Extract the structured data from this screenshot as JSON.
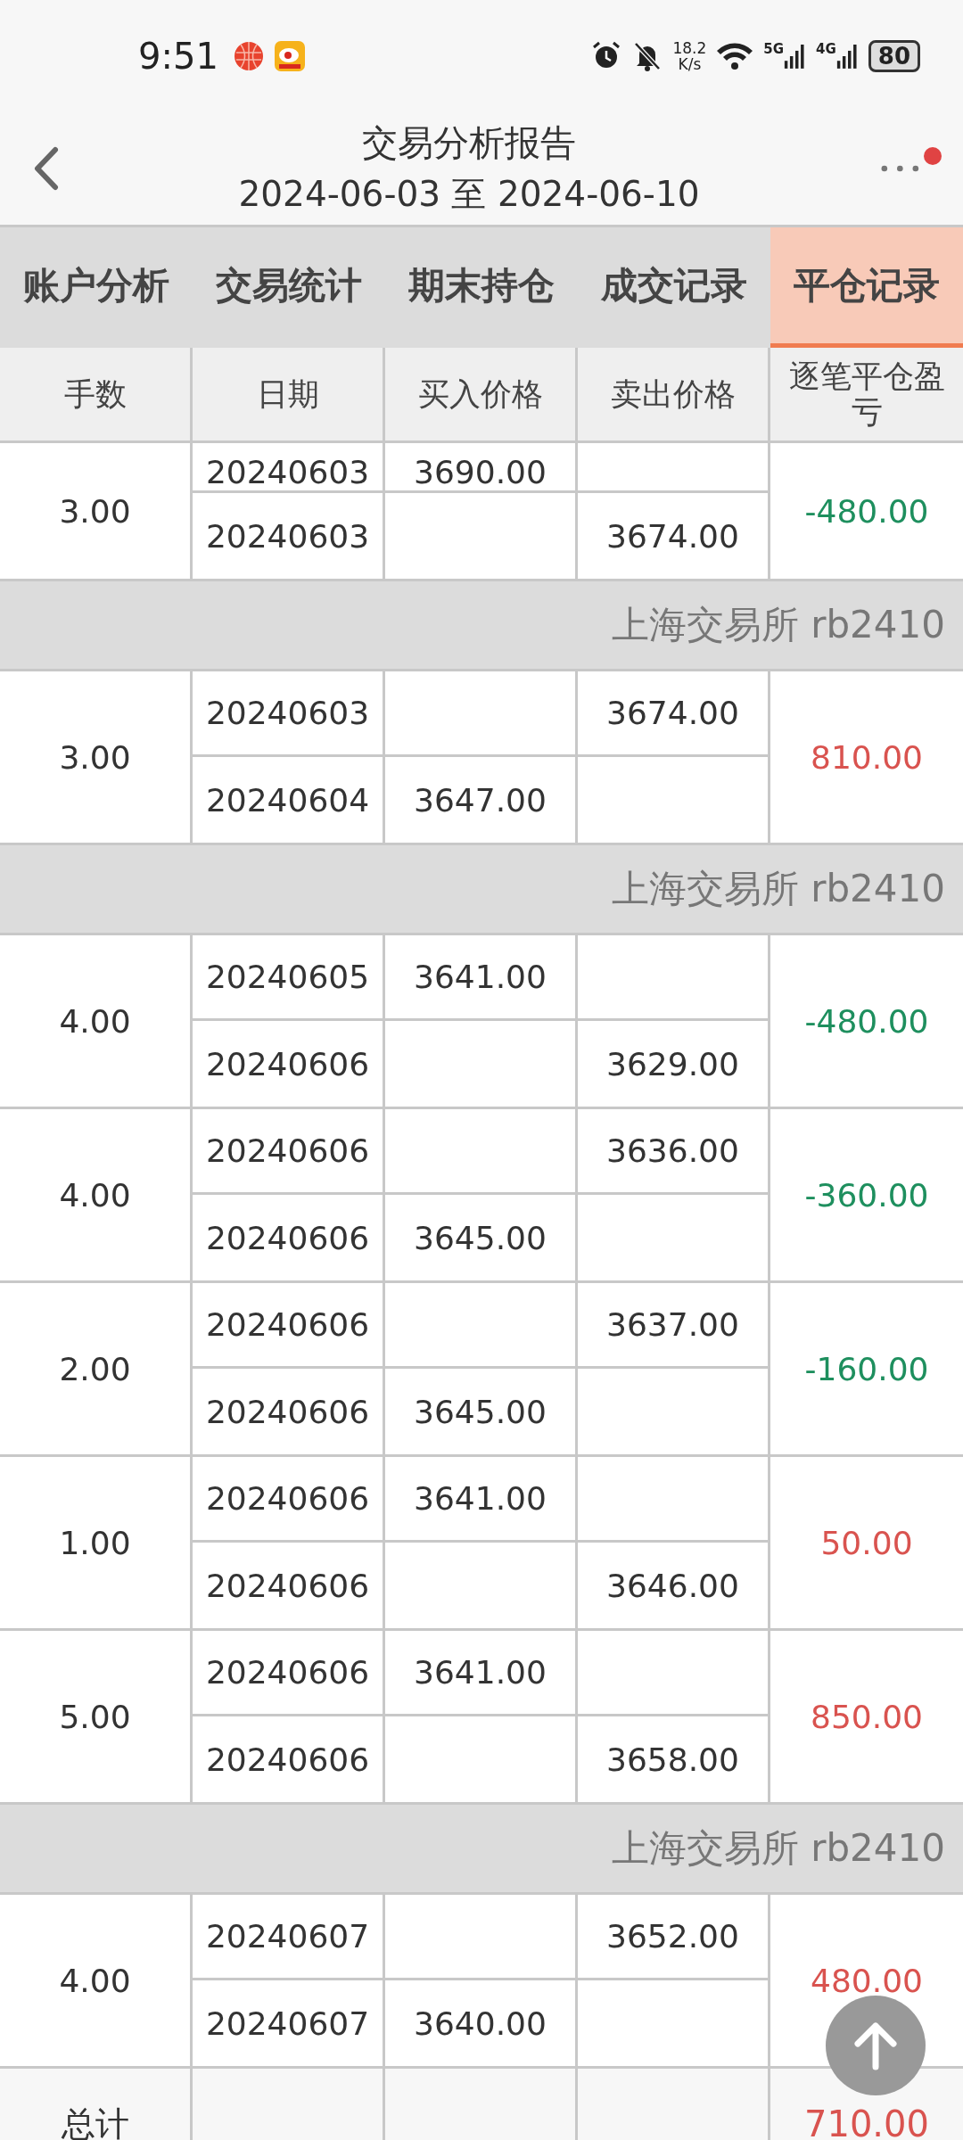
{
  "status_bar": {
    "time": "9:51",
    "speed_value": "18.2",
    "speed_unit": "K/s",
    "network_1": "5G",
    "network_2": "4G",
    "battery": "80"
  },
  "header": {
    "title": "交易分析报告",
    "subtitle": "2024-06-03 至 2024-06-10",
    "notification_dot": true
  },
  "tabs": [
    {
      "label": "账户分析",
      "selected": false
    },
    {
      "label": "交易统计",
      "selected": false
    },
    {
      "label": "期末持仓",
      "selected": false
    },
    {
      "label": "成交记录",
      "selected": false
    },
    {
      "label": "平仓记录",
      "selected": true
    }
  ],
  "table": {
    "columns": [
      "手数",
      "日期",
      "买入价格",
      "卖出价格",
      "逐笔平仓盈亏"
    ],
    "rows": [
      {
        "kind": "trade",
        "lots": "3.00",
        "pnl": "-480.00",
        "color": "#1e8f5e",
        "legs": [
          {
            "date": "20240603",
            "buy": "3690.00"
          },
          {
            "date": "20240603",
            "sell": "3674.00"
          }
        ]
      },
      {
        "kind": "exchange",
        "label": "上海交易所 rb2410"
      },
      {
        "kind": "trade",
        "lots": "3.00",
        "pnl": "810.00",
        "color": "#d9534f",
        "legs": [
          {
            "date": "20240603",
            "sell": "3674.00"
          },
          {
            "date": "20240604",
            "buy": "3647.00"
          }
        ]
      },
      {
        "kind": "exchange",
        "label": "上海交易所 rb2410"
      },
      {
        "kind": "trade",
        "lots": "4.00",
        "pnl": "-480.00",
        "color": "#1e8f5e",
        "legs": [
          {
            "date": "20240605",
            "buy": "3641.00"
          },
          {
            "date": "20240606",
            "sell": "3629.00"
          }
        ]
      },
      {
        "kind": "trade",
        "lots": "4.00",
        "pnl": "-360.00",
        "color": "#1e8f5e",
        "legs": [
          {
            "date": "20240606",
            "sell": "3636.00"
          },
          {
            "date": "20240606",
            "buy": "3645.00"
          }
        ]
      },
      {
        "kind": "trade",
        "lots": "2.00",
        "pnl": "-160.00",
        "color": "#1e8f5e",
        "legs": [
          {
            "date": "20240606",
            "sell": "3637.00"
          },
          {
            "date": "20240606",
            "buy": "3645.00"
          }
        ]
      },
      {
        "kind": "trade",
        "lots": "1.00",
        "pnl": "50.00",
        "color": "#d9534f",
        "legs": [
          {
            "date": "20240606",
            "buy": "3641.00"
          },
          {
            "date": "20240606",
            "sell": "3646.00"
          }
        ]
      },
      {
        "kind": "trade",
        "lots": "5.00",
        "pnl": "850.00",
        "color": "#d9534f",
        "legs": [
          {
            "date": "20240606",
            "buy": "3641.00"
          },
          {
            "date": "20240606",
            "sell": "3658.00"
          }
        ]
      },
      {
        "kind": "exchange",
        "label": "上海交易所 rb2410"
      },
      {
        "kind": "trade",
        "lots": "4.00",
        "pnl": "480.00",
        "color": "#d9534f",
        "legs": [
          {
            "date": "20240607",
            "sell": "3652.00"
          },
          {
            "date": "20240607",
            "buy": "3640.00"
          }
        ]
      }
    ],
    "total": {
      "label": "总计",
      "value": "710.00",
      "color": "#d9534f"
    }
  }
}
